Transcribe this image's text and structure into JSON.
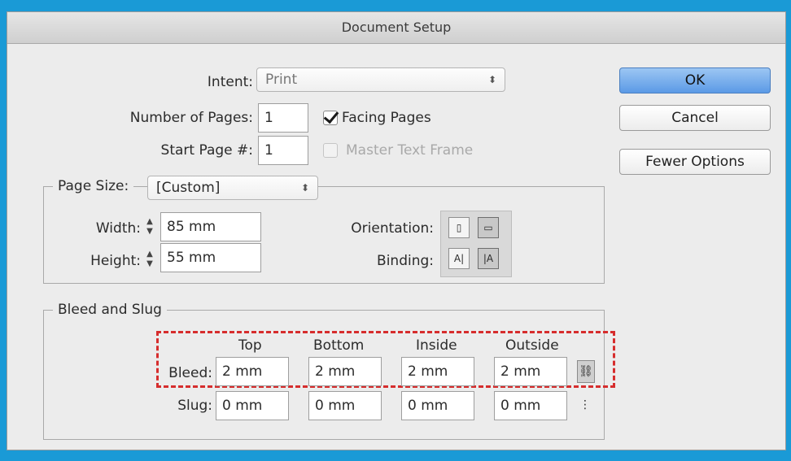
{
  "dialog": {
    "title": "Document Setup",
    "intent": {
      "label": "Intent:",
      "value": "Print"
    },
    "num_pages": {
      "label": "Number of Pages:",
      "value": "1"
    },
    "start_page": {
      "label": "Start Page #:",
      "value": "1"
    },
    "facing_pages": {
      "label": "Facing Pages",
      "checked": true
    },
    "master_text_frame": {
      "label": "Master Text Frame",
      "checked": false,
      "disabled": true
    },
    "buttons": {
      "ok": "OK",
      "cancel": "Cancel",
      "fewer": "Fewer Options"
    },
    "page_size": {
      "label": "Page Size:",
      "value": "[Custom]",
      "width_label": "Width:",
      "width_value": "85 mm",
      "height_label": "Height:",
      "height_value": "55 mm",
      "orientation_label": "Orientation:",
      "binding_label": "Binding:"
    },
    "bleed_slug": {
      "title": "Bleed and Slug",
      "columns": [
        "Top",
        "Bottom",
        "Inside",
        "Outside"
      ],
      "bleed_label": "Bleed:",
      "slug_label": "Slug:",
      "bleed": [
        "2 mm",
        "2 mm",
        "2 mm",
        "2 mm"
      ],
      "slug": [
        "0 mm",
        "0 mm",
        "0 mm",
        "0 mm"
      ]
    }
  },
  "icons": {
    "orientation_portrait": "portrait-icon",
    "orientation_landscape": "landscape-icon",
    "binding_left": "left-binding-icon",
    "binding_right": "right-binding-icon",
    "bleed_link": "chain-link-icon",
    "slug_link": "broken-chain-icon"
  },
  "colors": {
    "background": "#1a9ad6",
    "dialog": "#ececec",
    "ok_button": "#5b9ae6",
    "highlight_dash": "#d62d2d"
  }
}
